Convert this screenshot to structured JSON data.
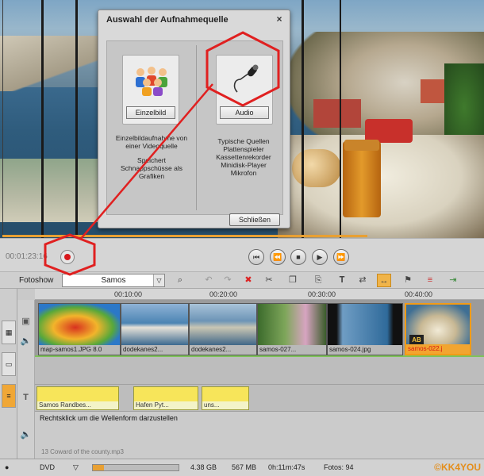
{
  "dialog": {
    "title": "Auswahl der Aufnahmequelle",
    "close_glyph": "×",
    "option1": {
      "button": "Einzelbild",
      "desc1": "Einzelbildaufnahme von",
      "desc2": "einer Videoquelle",
      "desc3": "Speichert",
      "desc4": "Schnappschüsse als",
      "desc5": "Grafiken"
    },
    "option2": {
      "button": "Audio",
      "desc1": "Typische Quellen",
      "desc2": "Plattenspieler",
      "desc3": "Kassettenrekorder",
      "desc4": "Minidisk-Player",
      "desc5": "Mikrofon"
    },
    "close_button": "Schließen"
  },
  "transport": {
    "timecode": "00:01:23:16",
    "buttons": [
      "⏮",
      "⏪",
      "■",
      "▶",
      "⏩"
    ]
  },
  "toolbar": {
    "label": "Fotoshow",
    "select_value": "Samos",
    "select_arrow": "▽"
  },
  "timeline": {
    "ruler": [
      "00:10:00",
      "00:20:00",
      "00:30:00",
      "00:40:00"
    ],
    "clips": [
      "map-samos1.JPG  8.0",
      "dodekanes2...",
      "dodekanes2...",
      "samos-027...",
      "samos-024.jpg",
      "samos-022.j"
    ],
    "titles": [
      "Samos   Randbes...",
      "Hafen Pyt...",
      "uns..."
    ],
    "audio_hint": "Rechtsklick um die Wellenform darzustellen",
    "audio_file": "13 Coward of the county.mp3",
    "ab_badge": "AB",
    "side_t": "T"
  },
  "status": {
    "media": "DVD",
    "media_arrow": "▽",
    "capacity": "4.38 GB",
    "used": "567 MB",
    "duration": "0h:11m:47s",
    "photos": "Fotos: 94",
    "fill_fraction": 0.13,
    "copyright": "©KK4YOU"
  },
  "colors": {
    "accent": "#f0a736",
    "record": "#d8181c",
    "annotation": "#e02020"
  }
}
